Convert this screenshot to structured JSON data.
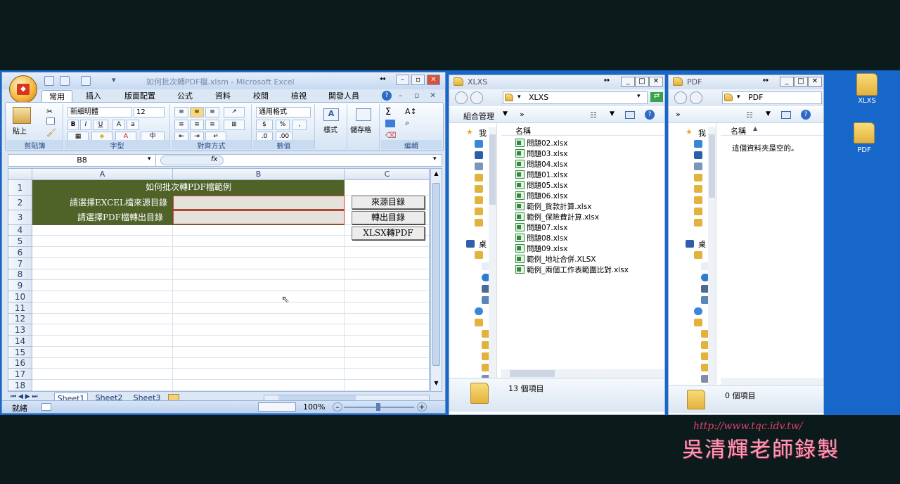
{
  "excel": {
    "title": "如何批次轉PDF檔.xlsm - Microsoft Excel",
    "tabs": [
      "常用",
      "插入",
      "版面配置",
      "公式",
      "資料",
      "校閱",
      "檢視",
      "開發人員"
    ],
    "ribbon": {
      "paste_label": "貼上",
      "font_name": "新細明體",
      "font_size": "12",
      "number_format": "通用格式",
      "style_label": "樣式",
      "cells_label": "儲存格",
      "groups": [
        "剪貼簿",
        "字型",
        "對齊方式",
        "數值",
        "編輯"
      ]
    },
    "name_box": "B8",
    "fx": "fx",
    "columns": [
      "A",
      "B",
      "C"
    ],
    "rows": [
      "1",
      "2",
      "3",
      "4",
      "5",
      "6",
      "7",
      "8",
      "9",
      "10",
      "11",
      "12",
      "13",
      "14",
      "15",
      "16",
      "17",
      "18"
    ],
    "cells": {
      "B1": "如何批次轉PDF檔範例",
      "A2": "請選擇EXCEL檔來源目錄",
      "A3": "請選擇PDF檔轉出目錄"
    },
    "buttons": {
      "source": "來源目錄",
      "output": "轉出目錄",
      "convert": "XLSX轉PDF"
    },
    "sheets": [
      "Sheet1",
      "Sheet2",
      "Sheet3"
    ],
    "status_ready": "就緒",
    "zoom": "100%"
  },
  "explorer_xlxs": {
    "title": "XLXS",
    "address": "XLXS",
    "organize": "組合管理",
    "more": "»",
    "nav_fav": "我",
    "nav_desktop": "桌",
    "column_name": "名稱",
    "files": [
      "問題02.xlsx",
      "問題03.xlsx",
      "問題04.xlsx",
      "問題01.xlsx",
      "問題05.xlsx",
      "問題06.xlsx",
      "範例_貨款計算.xlsx",
      "範例_保險費計算.xlsx",
      "問題07.xlsx",
      "問題08.xlsx",
      "問題09.xlsx",
      "範例_地址合併.XLSX",
      "範例_兩個工作表範圍比對.xlsx"
    ],
    "status": "13 個項目"
  },
  "explorer_pdf": {
    "title": "PDF",
    "address": "PDF",
    "more": "»",
    "nav_fav": "我",
    "nav_desktop": "桌",
    "column_name": "名稱",
    "empty_text": "這個資料夾是空的。",
    "status": "0 個項目"
  },
  "desktop": {
    "icons": [
      "XLXS",
      "PDF"
    ]
  },
  "watermark": {
    "url": "http://www.tqc.idv.tw/",
    "author": "吳清輝老師錄製"
  }
}
